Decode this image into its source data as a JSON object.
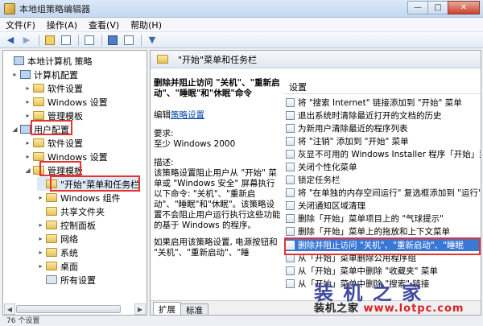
{
  "window": {
    "title": "本地组策略编辑器",
    "controls": {
      "minimize": "—",
      "maximize": "□",
      "close": "✕"
    }
  },
  "menu": [
    "文件(F)",
    "操作(A)",
    "查看(V)",
    "帮助(H)"
  ],
  "toolbar": {
    "icons": [
      "back-arrow-icon",
      "forward-arrow-icon",
      "folder-up-icon",
      "show-hide-tree-icon",
      "export-list-icon",
      "help-icon",
      "properties-icon",
      "filter-icon"
    ]
  },
  "tree": {
    "items": [
      {
        "label": "本地计算机 策略",
        "level": 0,
        "expander": "",
        "icon": "computer-policy-icon"
      },
      {
        "label": "计算机配置",
        "level": 1,
        "expander": "▸",
        "icon": "computer-config-icon"
      },
      {
        "label": "软件设置",
        "level": 2,
        "expander": "▸",
        "icon": "folder-icon"
      },
      {
        "label": "Windows 设置",
        "level": 2,
        "expander": "▸",
        "icon": "folder-icon"
      },
      {
        "label": "管理模板",
        "level": 2,
        "expander": "▸",
        "icon": "folder-icon"
      },
      {
        "label": "用户配置",
        "level": 1,
        "expander": "◢",
        "icon": "user-config-icon"
      },
      {
        "label": "软件设置",
        "level": 2,
        "expander": "▸",
        "icon": "folder-icon"
      },
      {
        "label": "Windows 设置",
        "level": 2,
        "expander": "▸",
        "icon": "folder-icon"
      },
      {
        "label": "管理模板",
        "level": 2,
        "expander": "◢",
        "icon": "folder-icon"
      },
      {
        "label": "\"开始\"菜单和任务栏",
        "level": 3,
        "expander": "",
        "icon": "folder-icon"
      },
      {
        "label": "Windows 组件",
        "level": 3,
        "expander": "▸",
        "icon": "folder-icon"
      },
      {
        "label": "共享文件夹",
        "level": 3,
        "expander": "",
        "icon": "folder-icon"
      },
      {
        "label": "控制面板",
        "level": 3,
        "expander": "▸",
        "icon": "folder-icon"
      },
      {
        "label": "网络",
        "level": 3,
        "expander": "▸",
        "icon": "folder-icon"
      },
      {
        "label": "系统",
        "level": 3,
        "expander": "▸",
        "icon": "folder-icon"
      },
      {
        "label": "桌面",
        "level": 3,
        "expander": "▸",
        "icon": "folder-icon"
      },
      {
        "label": "所有设置",
        "level": 3,
        "expander": "",
        "icon": "all-settings-icon"
      }
    ]
  },
  "content_header": "\"开始\"菜单和任务栏",
  "description": {
    "title": "删除并阻止访问 \"关机\"、\"重新启动\"、\"睡眠\"和\"休眠\"命令",
    "edit_prefix": "编辑",
    "edit_link": "策略设置",
    "req_label": "要求:",
    "req_value": "至少 Windows 2000",
    "desc_label": "描述:",
    "desc_text": "该策略设置阻止用户从 \"开始\" 菜单或 \"Windows 安全\" 屏幕执行以下命令: \"关机\"、\"重新启动\"、\"睡眠\"和\"休眠\"。该策略设置不会阻止用户运行执行这些功能的基于 Windows 的程序。",
    "desc_text2": "如果启用该策略设置, 电源按钮和 \"关机\"、\"重新启动\"、\"睡"
  },
  "settings_header": "设置",
  "settings": [
    "将 \"搜索 Internet\" 链接添加到 \"开始\" 菜单",
    "退出系统时清除最近打开的文档的历史",
    "为新用户清除最近的程序列表",
    "将 \"注销\" 添加到 \"开始\" 菜单",
    "灰显不可用的 Windows Installer 程序「开始」菜单",
    "关闭个性化菜单",
    "锁定任务栏",
    "将 \"在单独的内存空间运行\" 复选框添加到 \"运行\"",
    "关闭通知区域清理",
    "删除「开始」菜单项目上的 \"气球提示\"",
    "删除「开始」菜单上的拖放和上下文菜单",
    "删除并阻止访问 \"关机\"、\"重新启动\"、\"睡眠",
    "从「开始」菜单删除公用程序组",
    "从「开始」菜单中删除 \"收藏夹\" 菜单",
    "从「开始」菜单中删除 \"搜索\" 链接"
  ],
  "tabs": [
    "扩展",
    "标准"
  ],
  "status": "76 个设置",
  "watermark": {
    "big": "装 机 之 家",
    "small_cn": "装机之家",
    "url": "www.lotpc.com"
  },
  "colors": {
    "highlight_red": "#e53430",
    "selection_blue": "#3a78d6"
  }
}
